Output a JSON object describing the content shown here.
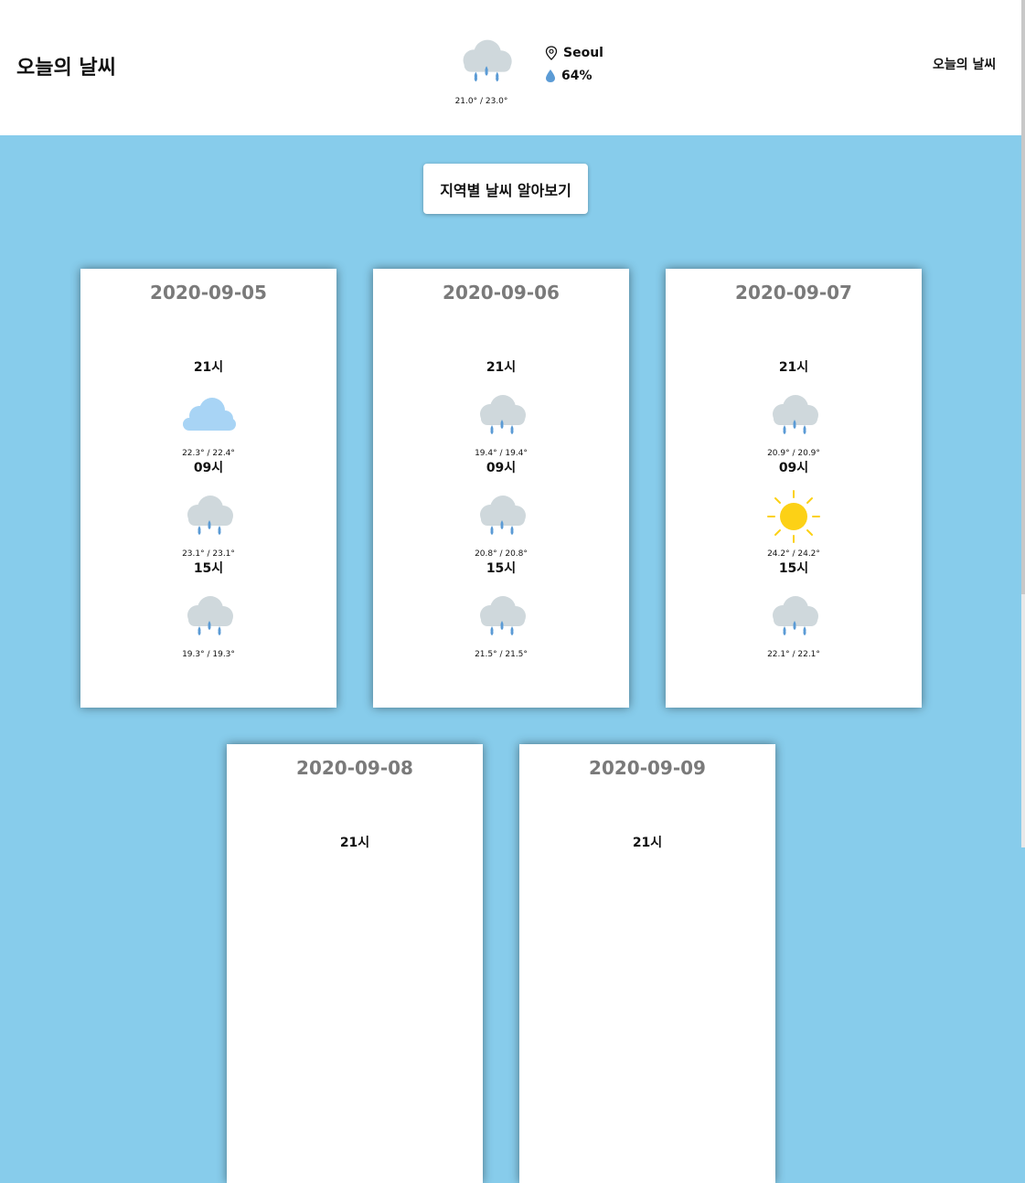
{
  "header": {
    "site_title": "오늘의 날씨",
    "nav_label": "오늘의 날씨",
    "today": {
      "icon": "rain-cloud-icon",
      "temp_range": "21.0° / 23.0°",
      "location": "Seoul",
      "humidity": "64%"
    }
  },
  "region_button_label": "지역별 날씨 알아보기",
  "colors": {
    "background": "#87cceb",
    "date_text": "#7a7a7a",
    "cloud": "#cfd8dc",
    "rain_drop": "#5b9bd5",
    "light_cloud": "#a8d4f5",
    "sun": "#fcd116"
  },
  "forecast": [
    {
      "date": "2020-09-05",
      "slots": [
        {
          "time": "21시",
          "icon": "cloud-icon",
          "temp": "22.3° / 22.4°"
        },
        {
          "time": "09시",
          "icon": "rain-cloud-icon",
          "temp": "23.1° / 23.1°"
        },
        {
          "time": "15시",
          "icon": "rain-cloud-icon",
          "temp": "19.3° / 19.3°"
        }
      ]
    },
    {
      "date": "2020-09-06",
      "slots": [
        {
          "time": "21시",
          "icon": "rain-cloud-icon",
          "temp": "19.4° / 19.4°"
        },
        {
          "time": "09시",
          "icon": "rain-cloud-icon",
          "temp": "20.8° / 20.8°"
        },
        {
          "time": "15시",
          "icon": "rain-cloud-icon",
          "temp": "21.5° / 21.5°"
        }
      ]
    },
    {
      "date": "2020-09-07",
      "slots": [
        {
          "time": "21시",
          "icon": "rain-cloud-icon",
          "temp": "20.9° / 20.9°"
        },
        {
          "time": "09시",
          "icon": "sun-icon",
          "temp": "24.2° / 24.2°"
        },
        {
          "time": "15시",
          "icon": "rain-cloud-icon",
          "temp": "22.1° / 22.1°"
        }
      ]
    },
    {
      "date": "2020-09-08",
      "slots": [
        {
          "time": "21시"
        }
      ]
    },
    {
      "date": "2020-09-09",
      "slots": [
        {
          "time": "21시"
        }
      ]
    }
  ]
}
